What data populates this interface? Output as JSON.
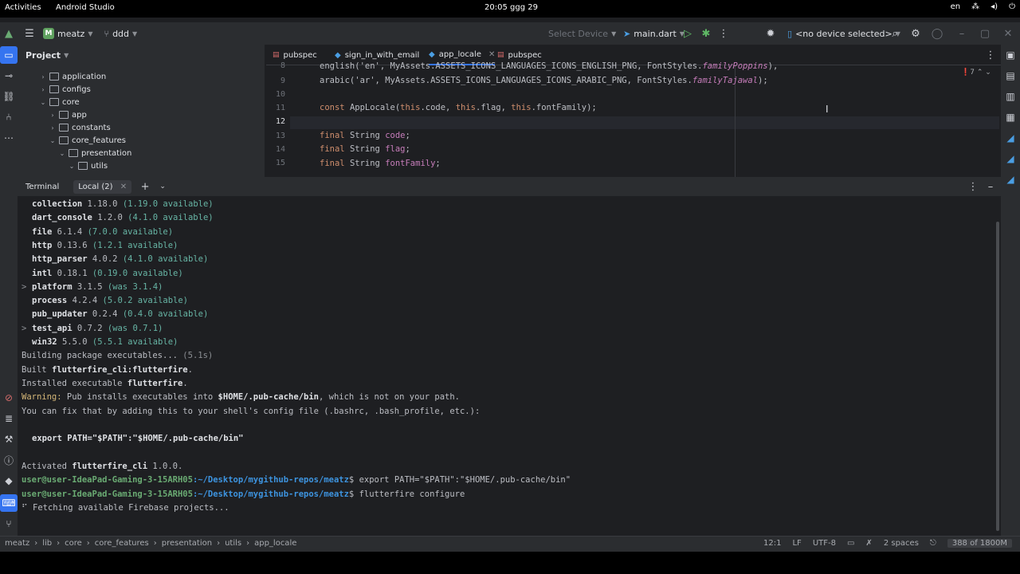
{
  "os": {
    "activities": "Activities",
    "app_name": "Android Studio",
    "clock": "20:05 ggg 29",
    "language": "en"
  },
  "toolbar": {
    "project_badge": "M",
    "project_name": "meatz",
    "branch": "ddd",
    "device_select": "Select Device",
    "run_config": "main.dart",
    "device_label": "<no device selected>"
  },
  "project_panel": {
    "title": "Project",
    "tree": [
      {
        "label": "application",
        "depth": 2,
        "expanded": false
      },
      {
        "label": "configs",
        "depth": 2,
        "expanded": false
      },
      {
        "label": "core",
        "depth": 2,
        "expanded": true
      },
      {
        "label": "app",
        "depth": 3,
        "expanded": false
      },
      {
        "label": "constants",
        "depth": 3,
        "expanded": false
      },
      {
        "label": "core_features",
        "depth": 3,
        "expanded": true
      },
      {
        "label": "presentation",
        "depth": 4,
        "expanded": true
      },
      {
        "label": "utils",
        "depth": 5,
        "expanded": true
      }
    ]
  },
  "editor": {
    "tabs": [
      {
        "label": "pubspec",
        "type": "yaml",
        "active": false
      },
      {
        "label": "sign_in_with_email",
        "type": "dart",
        "active": false
      },
      {
        "label": "app_locale",
        "type": "dart",
        "active": true
      },
      {
        "label": "pubspec",
        "type": "yaml",
        "active": false
      }
    ],
    "warnings_count": "7",
    "line_numbers": [
      "8",
      "9",
      "10",
      "11",
      "12",
      "13",
      "14",
      "15"
    ],
    "lines": {
      "l8a": "english('en', ",
      "l8b": "MyAssets.ASSETS_ICONS_LANGUAGES_ICONS_ENGLISH_PNG, FontStyles.",
      "l8c": "familyPoppins",
      "l8d": "),",
      "l9a": "arabic('ar', ",
      "l9b": "MyAssets.ASSETS_ICONS_LANGUAGES_ICONS_ARABIC_PNG, FontStyles.",
      "l9c": "familyTajawal",
      "l9d": ");",
      "l11a": "const ",
      "l11b": "AppLocale(",
      "l11c": "this",
      "l11d": ".code, ",
      "l11e": "this",
      "l11f": ".flag, ",
      "l11g": "this",
      "l11h": ".fontFamily);",
      "l13a": "final ",
      "l13b": "String ",
      "l13c": "code",
      "l13d": ";",
      "l14a": "final ",
      "l14b": "String ",
      "l14c": "flag",
      "l14d": ";",
      "l15a": "final ",
      "l15b": "String ",
      "l15c": "fontFamily",
      "l15d": ";"
    }
  },
  "terminal": {
    "tab_title": "Terminal",
    "session": "Local (2)",
    "packages": [
      {
        "name": "collection",
        "ver": "1.18.0",
        "note": "(1.19.0 available)",
        "marker": ""
      },
      {
        "name": "dart_console",
        "ver": "1.2.0",
        "note": "(4.1.0 available)",
        "marker": ""
      },
      {
        "name": "file",
        "ver": "6.1.4",
        "note": "(7.0.0 available)",
        "marker": ""
      },
      {
        "name": "http",
        "ver": "0.13.6",
        "note": "(1.2.1 available)",
        "marker": ""
      },
      {
        "name": "http_parser",
        "ver": "4.0.2",
        "note": "(4.1.0 available)",
        "marker": ""
      },
      {
        "name": "intl",
        "ver": "0.18.1",
        "note": "(0.19.0 available)",
        "marker": ""
      },
      {
        "name": "platform",
        "ver": "3.1.5",
        "note": "(was 3.1.4)",
        "marker": ">"
      },
      {
        "name": "process",
        "ver": "4.2.4",
        "note": "(5.0.2 available)",
        "marker": ""
      },
      {
        "name": "pub_updater",
        "ver": "0.2.4",
        "note": "(0.4.0 available)",
        "marker": ""
      },
      {
        "name": "test_api",
        "ver": "0.7.2",
        "note": "(was 0.7.1)",
        "marker": ">"
      },
      {
        "name": "win32",
        "ver": "5.5.0",
        "note": "(5.5.1 available)",
        "marker": ""
      }
    ],
    "building": "Building package executables... ",
    "building_time": "(5.1s)",
    "built_prefix": "Built ",
    "built_name": "flutterfire_cli:flutterfire",
    "built_suffix": ".",
    "installed_prefix": "Installed executable ",
    "installed_name": "flutterfire",
    "installed_suffix": ".",
    "warning_label": "Warning:",
    "warning_text_a": " Pub installs executables into ",
    "warning_path": "$HOME/.pub-cache/bin",
    "warning_text_b": ", which is not on your path.",
    "fix_text": "You can fix that by adding this to your shell's config file (.bashrc, .bash_profile, etc.):",
    "export_line": "export PATH=\"$PATH\":\"$HOME/.pub-cache/bin\"",
    "activated_prefix": "Activated ",
    "activated_name": "flutterfire_cli",
    "activated_suffix": " 1.0.0.",
    "prompt_user": "user@user-IdeaPad-Gaming-3-15ARH05",
    "prompt_path": ":~/Desktop/mygithub-repos/meatz",
    "prompt_symbol": "$ ",
    "cmd1": "export PATH=\"$PATH\":\"$HOME/.pub-cache/bin\"",
    "cmd2": "flutterfire configure",
    "spinner": "⠋",
    "fetching": " Fetching available Firebase projects..."
  },
  "status_bar": {
    "crumbs": [
      "meatz",
      "lib",
      "core",
      "core_features",
      "presentation",
      "utils",
      "app_locale"
    ],
    "caret": "12:1",
    "line_sep": "LF",
    "encoding": "UTF-8",
    "indent": "2 spaces",
    "memory": "388 of 1800M"
  }
}
